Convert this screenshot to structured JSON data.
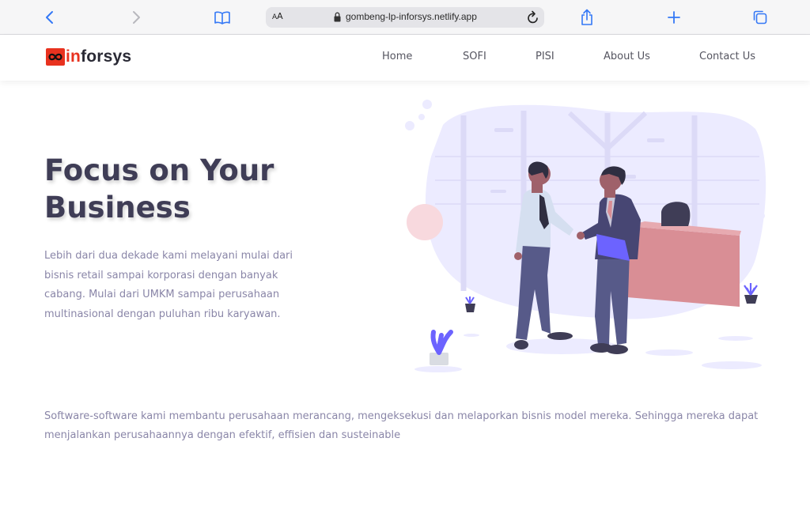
{
  "browser": {
    "url": "gombeng-lp-inforsys.netlify.app",
    "reader_label": "AA"
  },
  "logo": {
    "part_in": "in",
    "part_forsys": "forsys",
    "accent_color": "#e8321f"
  },
  "nav": {
    "items": [
      {
        "label": "Home"
      },
      {
        "label": "SOFI"
      },
      {
        "label": "PISI"
      },
      {
        "label": "About Us"
      },
      {
        "label": "Contact Us"
      }
    ]
  },
  "hero": {
    "title": "Focus on Your Business",
    "description": "Lebih dari dua dekade kami melayani mulai dari bisnis retail sampai korporasi dengan banyak cabang. Mulai dari UMKM sampai perusahaan multinasional dengan puluhan ribu karyawan.",
    "illustration": "business-handshake-illustration"
  },
  "intro": {
    "text": "Software-software kami membantu perusahaan merancang, mengeksekusi dan melaporkan bisnis model mereka. Sehingga mereka dapat menjalankan perusahaannya dengan efektif, effisien dan susteinable"
  },
  "colors": {
    "title": "#3f3d56",
    "body_text": "#8a86a8",
    "accent_purple": "#6c63ff",
    "accent_pink": "#d98e95"
  }
}
